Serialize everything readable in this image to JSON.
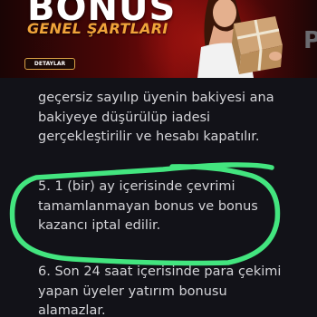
{
  "banner": {
    "title": "BONUS",
    "subtitle": "GENEL ŞARTLARI",
    "details_button": "DETAYLAR",
    "edge_letter": "P"
  },
  "paragraphs": [
    {
      "lines": [
        "geçersiz sayılıp üyenin bakiyesi ana",
        "bakiyeye düşürülüp iadesi",
        "gerçekleştirilir ve hesabı kapatılır."
      ]
    },
    {
      "lines": [
        "5. 1 (bir) ay içerisinde çevrimi",
        "tamamlanmayan bonus ve bonus",
        "kazancı iptal edilir."
      ]
    },
    {
      "lines": [
        "6. Son 24 saat içerisinde para çekimi",
        "yapan üyeler yatırım bonusu",
        "alamazlar."
      ]
    }
  ],
  "colors": {
    "highlight": "#43e57f",
    "accent": "#f0a43a",
    "text": "#d4d4d8"
  }
}
